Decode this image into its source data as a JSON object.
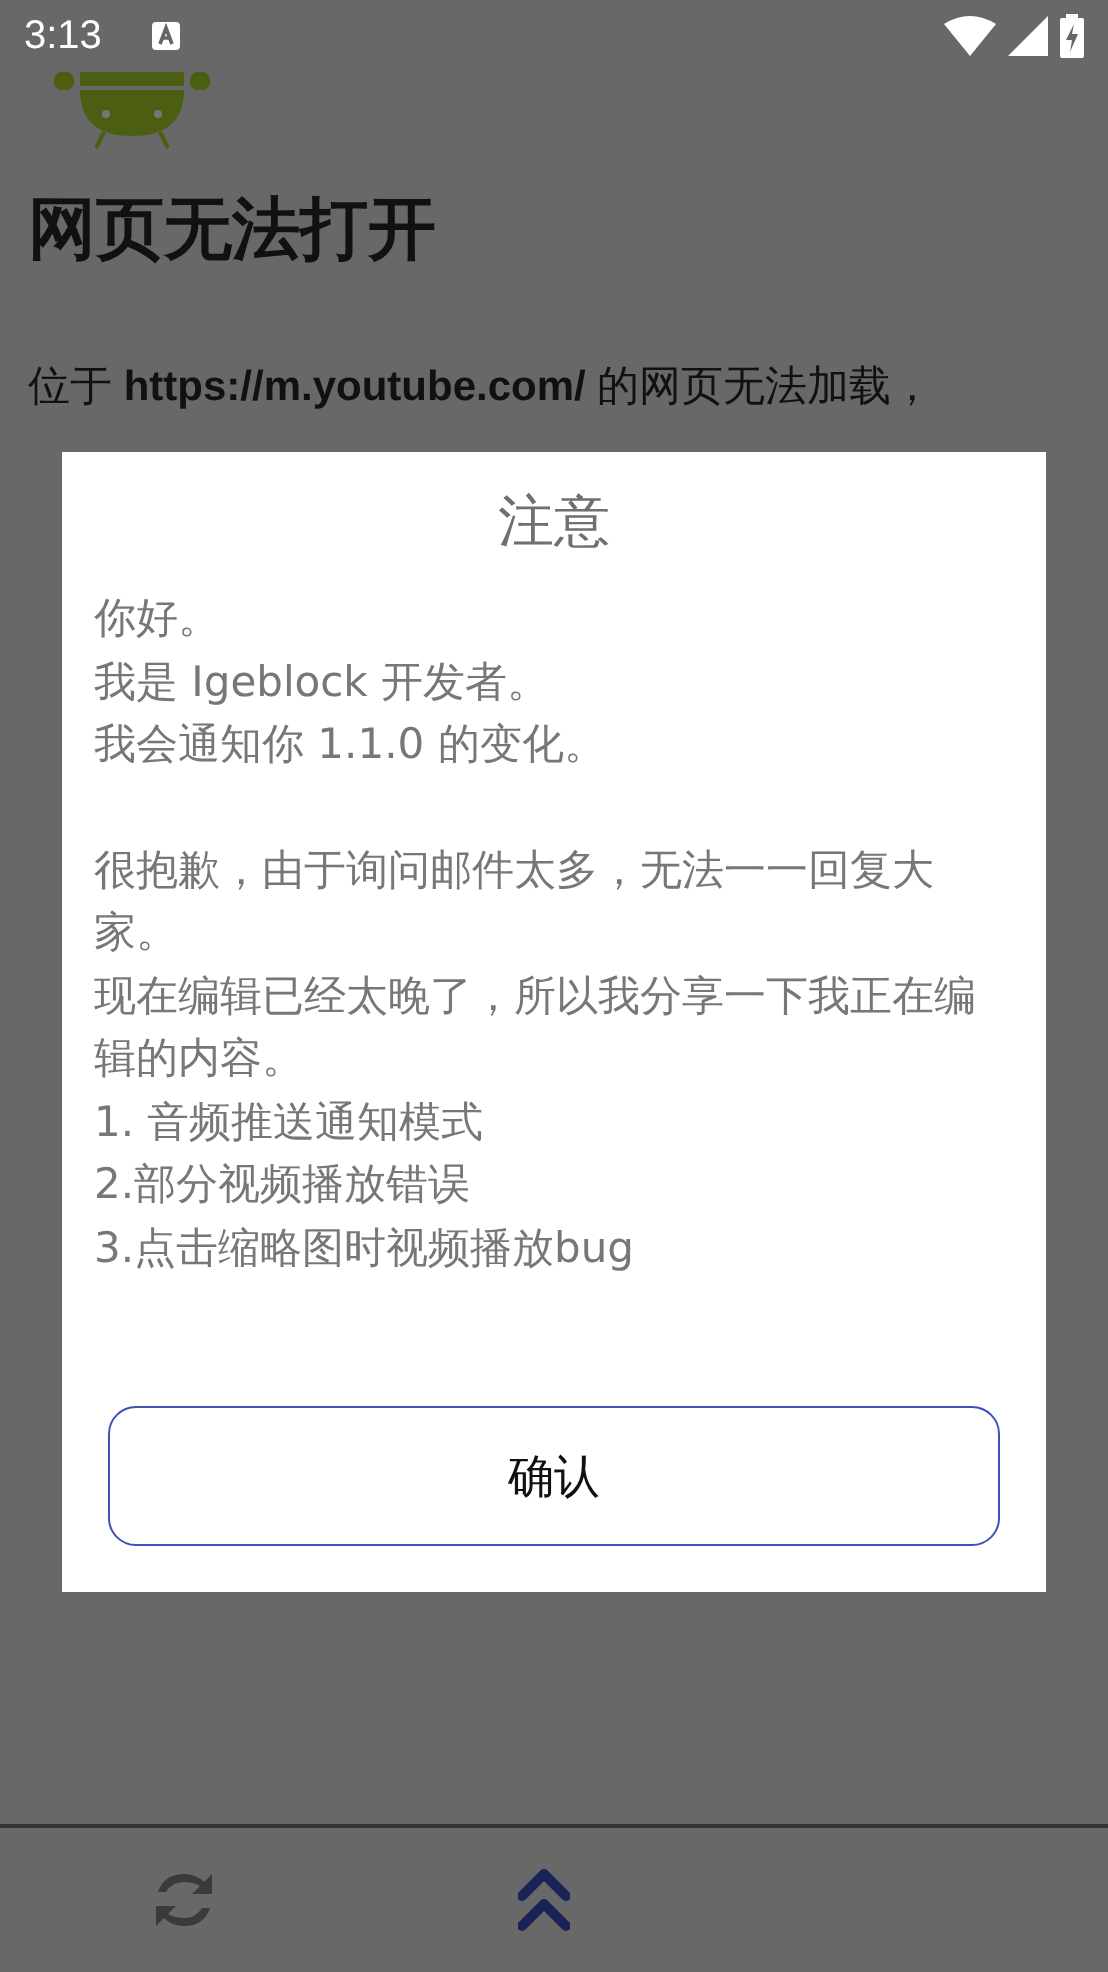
{
  "status_bar": {
    "time": "3:13"
  },
  "page": {
    "title": "网页无法打开",
    "message": "位于 **https://m.youtube.com/** 的网页无法加载，"
  },
  "dialog": {
    "title": "注意",
    "paragraphs": [
      [
        "你好。",
        "我是 Igeblock 开发者。",
        "我会通知你 1.1.0 的变化。"
      ],
      [
        "很抱歉，由于询问邮件太多，无法一一回复大家。",
        "现在编辑已经太晚了，所以我分享一下我正在编辑的内容。",
        "1. 音频推送通知模式",
        "2.部分视频播放错误",
        "3.点击缩略图时视频播放bug"
      ]
    ],
    "button": "确认"
  }
}
